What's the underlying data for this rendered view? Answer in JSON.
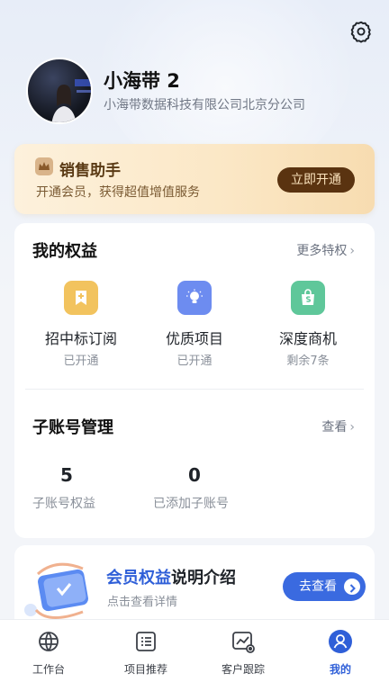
{
  "profile": {
    "name": "小海带 2",
    "company": "小海带数据科技有限公司北京分公司"
  },
  "icons": {
    "settings": "gear-icon"
  },
  "vip": {
    "title": "销售助手",
    "subtitle": "开通会员，获得超值增值服务",
    "button": "立即开通"
  },
  "rights": {
    "title": "我的权益",
    "more": "更多特权",
    "items": [
      {
        "name": "招中标订阅",
        "status": "已开通",
        "icon": "bookmark-plus-icon",
        "color": "#f2c35e"
      },
      {
        "name": "优质项目",
        "status": "已开通",
        "icon": "lightbulb-icon",
        "color": "#6d8cf0"
      },
      {
        "name": "深度商机",
        "status": "剩余7条",
        "icon": "shopping-bag-icon",
        "color": "#5fc79a"
      }
    ]
  },
  "subaccount": {
    "title": "子账号管理",
    "more": "查看",
    "stats": [
      {
        "value": "5",
        "label": "子账号权益"
      },
      {
        "value": "0",
        "label": "已添加子账号"
      }
    ]
  },
  "intro": {
    "title_highlight": "会员权益",
    "title_rest": "说明介绍",
    "subtitle": "点击查看详情",
    "button": "去查看"
  },
  "tabs": [
    {
      "label": "工作台",
      "icon": "globe-icon"
    },
    {
      "label": "项目推荐",
      "icon": "list-icon"
    },
    {
      "label": "客户跟踪",
      "icon": "chart-eye-icon"
    },
    {
      "label": "我的",
      "icon": "user-icon",
      "active": true
    }
  ],
  "colors": {
    "accent": "#2f5fd8",
    "vip_button": "#5a3310"
  }
}
